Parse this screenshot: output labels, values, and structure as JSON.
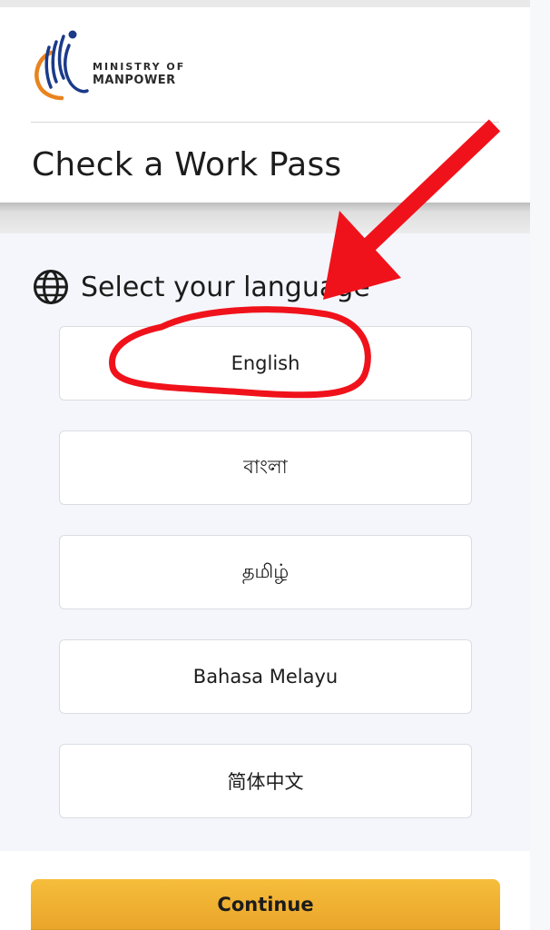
{
  "header": {
    "logo": {
      "line1": "MINISTRY OF",
      "line2": "MANPOWER"
    },
    "title": "Check a Work Pass"
  },
  "language_section": {
    "heading": "Select your language",
    "icon": "globe-icon",
    "options": [
      {
        "label": "English"
      },
      {
        "label": "বাংলা"
      },
      {
        "label": "தமிழ்"
      },
      {
        "label": "Bahasa Melayu"
      },
      {
        "label": "简体中文"
      }
    ]
  },
  "footer": {
    "continue_label": "Continue"
  },
  "colors": {
    "accent_button": "#eaa52a",
    "background": "#f4f6fb",
    "annotation": "#f0121b"
  }
}
